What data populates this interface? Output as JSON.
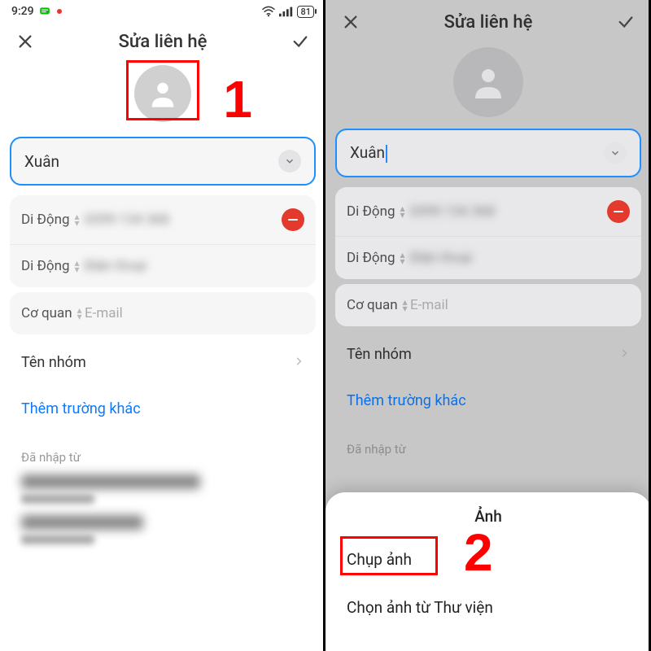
{
  "status": {
    "time": "9:29",
    "battery": "81"
  },
  "header": {
    "title": "Sửa liên hệ"
  },
  "name_field": {
    "value": "Xuân"
  },
  "rows": {
    "mobile_label": "Di Động",
    "mobile1_value": "0399 134 368",
    "mobile2_placeholder": "Điện thoại",
    "org_label": "Cơ quan",
    "email_placeholder": "E-mail"
  },
  "group_row": "Tên nhóm",
  "add_more": "Thêm trường khác",
  "imported_from": "Đã nhập từ",
  "imported_items": [
    {
      "title": "Tài khoản Mi liên hệ",
      "sub": "021207050"
    },
    {
      "title": "Zalo liên hệ",
      "sub": "ZaloAccount"
    }
  ],
  "sheet": {
    "title": "Ảnh",
    "opt1": "Chụp ảnh",
    "opt2": "Chọn ảnh từ Thư viện"
  },
  "annotations": {
    "one": "1",
    "two": "2"
  }
}
